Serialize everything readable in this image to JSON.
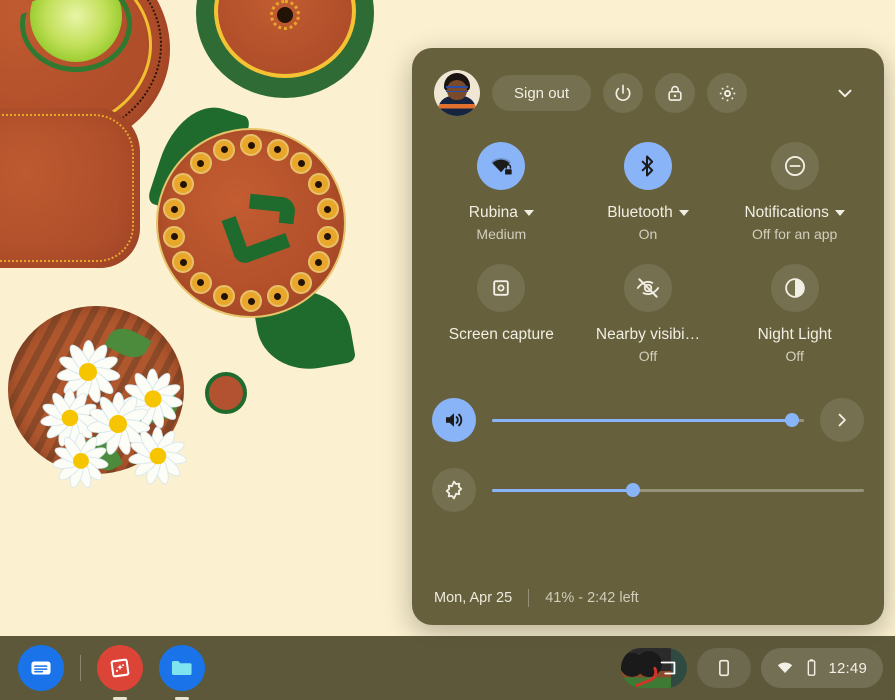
{
  "wallpaper": {
    "description": "Illustrated terracotta pottery plates with gold dot patterns, green leaves, limes and a basket of white daisies on a cream background",
    "background_color": "#FBF0CF"
  },
  "quick_settings": {
    "panel_color": "#66603C",
    "accent_color": "#8AB4F8",
    "header": {
      "avatar_name": "user-avatar",
      "sign_out_label": "Sign out",
      "power_icon": "power-icon",
      "lock_icon": "lock-icon",
      "settings_icon": "gear-icon",
      "collapse_icon": "chevron-down-icon"
    },
    "tiles": [
      {
        "icon": "wifi-locked-icon",
        "label": "Rubina",
        "sublabel": "Medium",
        "active": true,
        "has_caret": true
      },
      {
        "icon": "bluetooth-icon",
        "label": "Bluetooth",
        "sublabel": "On",
        "active": true,
        "has_caret": true
      },
      {
        "icon": "do-not-disturb-icon",
        "label": "Notifications",
        "sublabel": "Off for an app",
        "active": false,
        "has_caret": true
      },
      {
        "icon": "screen-capture-icon",
        "label": "Screen capture",
        "sublabel": "",
        "active": false,
        "has_caret": false
      },
      {
        "icon": "nearby-share-off-icon",
        "label": "Nearby visibi…",
        "sublabel": "Off",
        "active": false,
        "has_caret": false
      },
      {
        "icon": "night-light-icon",
        "label": "Night Light",
        "sublabel": "Off",
        "active": false,
        "has_caret": false
      }
    ],
    "sliders": [
      {
        "name": "volume",
        "icon": "volume-up-icon",
        "value": 96,
        "active": true,
        "expand_icon": "chevron-right-icon"
      },
      {
        "name": "brightness",
        "icon": "brightness-icon",
        "value": 38,
        "active": false
      }
    ],
    "footer": {
      "date": "Mon, Apr 25",
      "battery": "41% - 2:42 left"
    }
  },
  "shelf": {
    "apps": [
      {
        "name": "chat-app",
        "color": "#1A73E8",
        "running": false
      },
      {
        "name": "photo-effects-app",
        "color": "#DB4437",
        "running": true
      },
      {
        "name": "files-app",
        "color": "#1A73E8",
        "running": true
      }
    ],
    "status": {
      "cast_icon": "screen-cast-icon",
      "phone_hub_icon": "phone-hub-icon",
      "wifi_icon": "wifi-icon",
      "battery_icon": "battery-icon",
      "time": "12:49"
    }
  }
}
